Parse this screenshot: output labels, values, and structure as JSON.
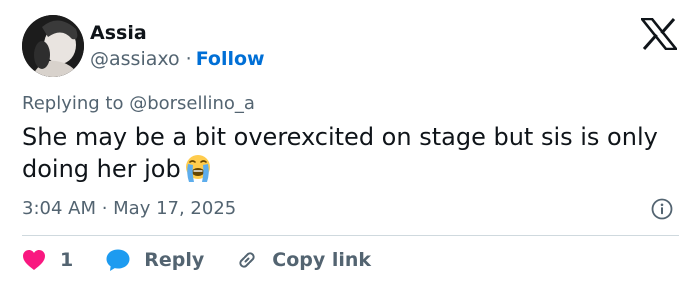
{
  "author": {
    "name": "Assia",
    "handle": "@assiaxo",
    "separator": "·",
    "follow_label": "Follow"
  },
  "tweet": {
    "replying_prefix": "Replying to",
    "replying_to": "@borsellino_a",
    "text": "She may be a bit overexcited on stage but sis is only doing her job",
    "emoji": "loudly-crying-face-emoji",
    "timestamp": "3:04 AM · May 17, 2025"
  },
  "actions": {
    "like_count": "1",
    "reply_label": "Reply",
    "copy_link_label": "Copy link"
  },
  "icons": {
    "logo": "x-logo-icon",
    "info": "info-icon",
    "like": "heart-icon",
    "reply": "speech-bubble-icon",
    "copy": "link-icon"
  },
  "colors": {
    "text": "#0f1419",
    "secondary": "#536471",
    "link": "#006fd6",
    "like": "#f91880",
    "reply": "#1d9bf0",
    "divider": "#cfd9de"
  }
}
